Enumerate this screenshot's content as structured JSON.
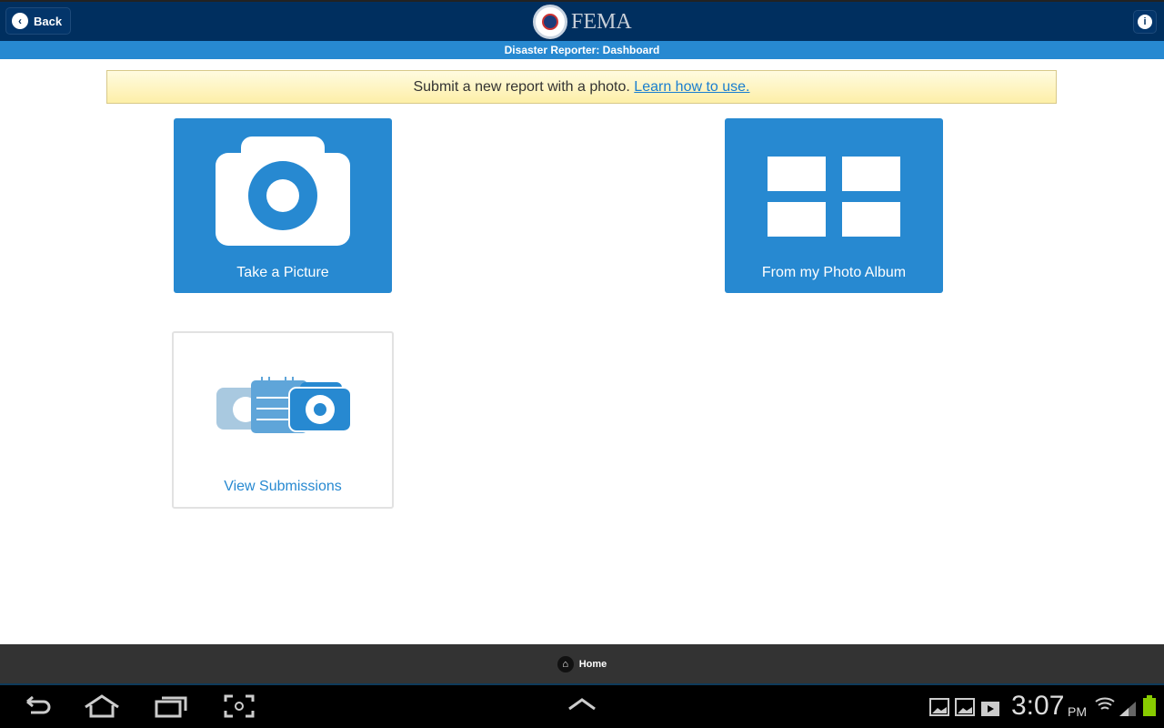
{
  "header": {
    "back_label": "Back",
    "logo_text": "FEMA",
    "subtitle": "Disaster Reporter: Dashboard"
  },
  "banner": {
    "text": "Submit a new report with a photo.",
    "link": "Learn how to use."
  },
  "tiles": [
    {
      "label": "Take a Picture"
    },
    {
      "label": "From my Photo Album"
    },
    {
      "label": "View Submissions"
    }
  ],
  "footer": {
    "home_label": "Home"
  },
  "status": {
    "time": "3:07",
    "ampm": "PM"
  },
  "colors": {
    "navy": "#002f5f",
    "blue": "#2789d1"
  }
}
